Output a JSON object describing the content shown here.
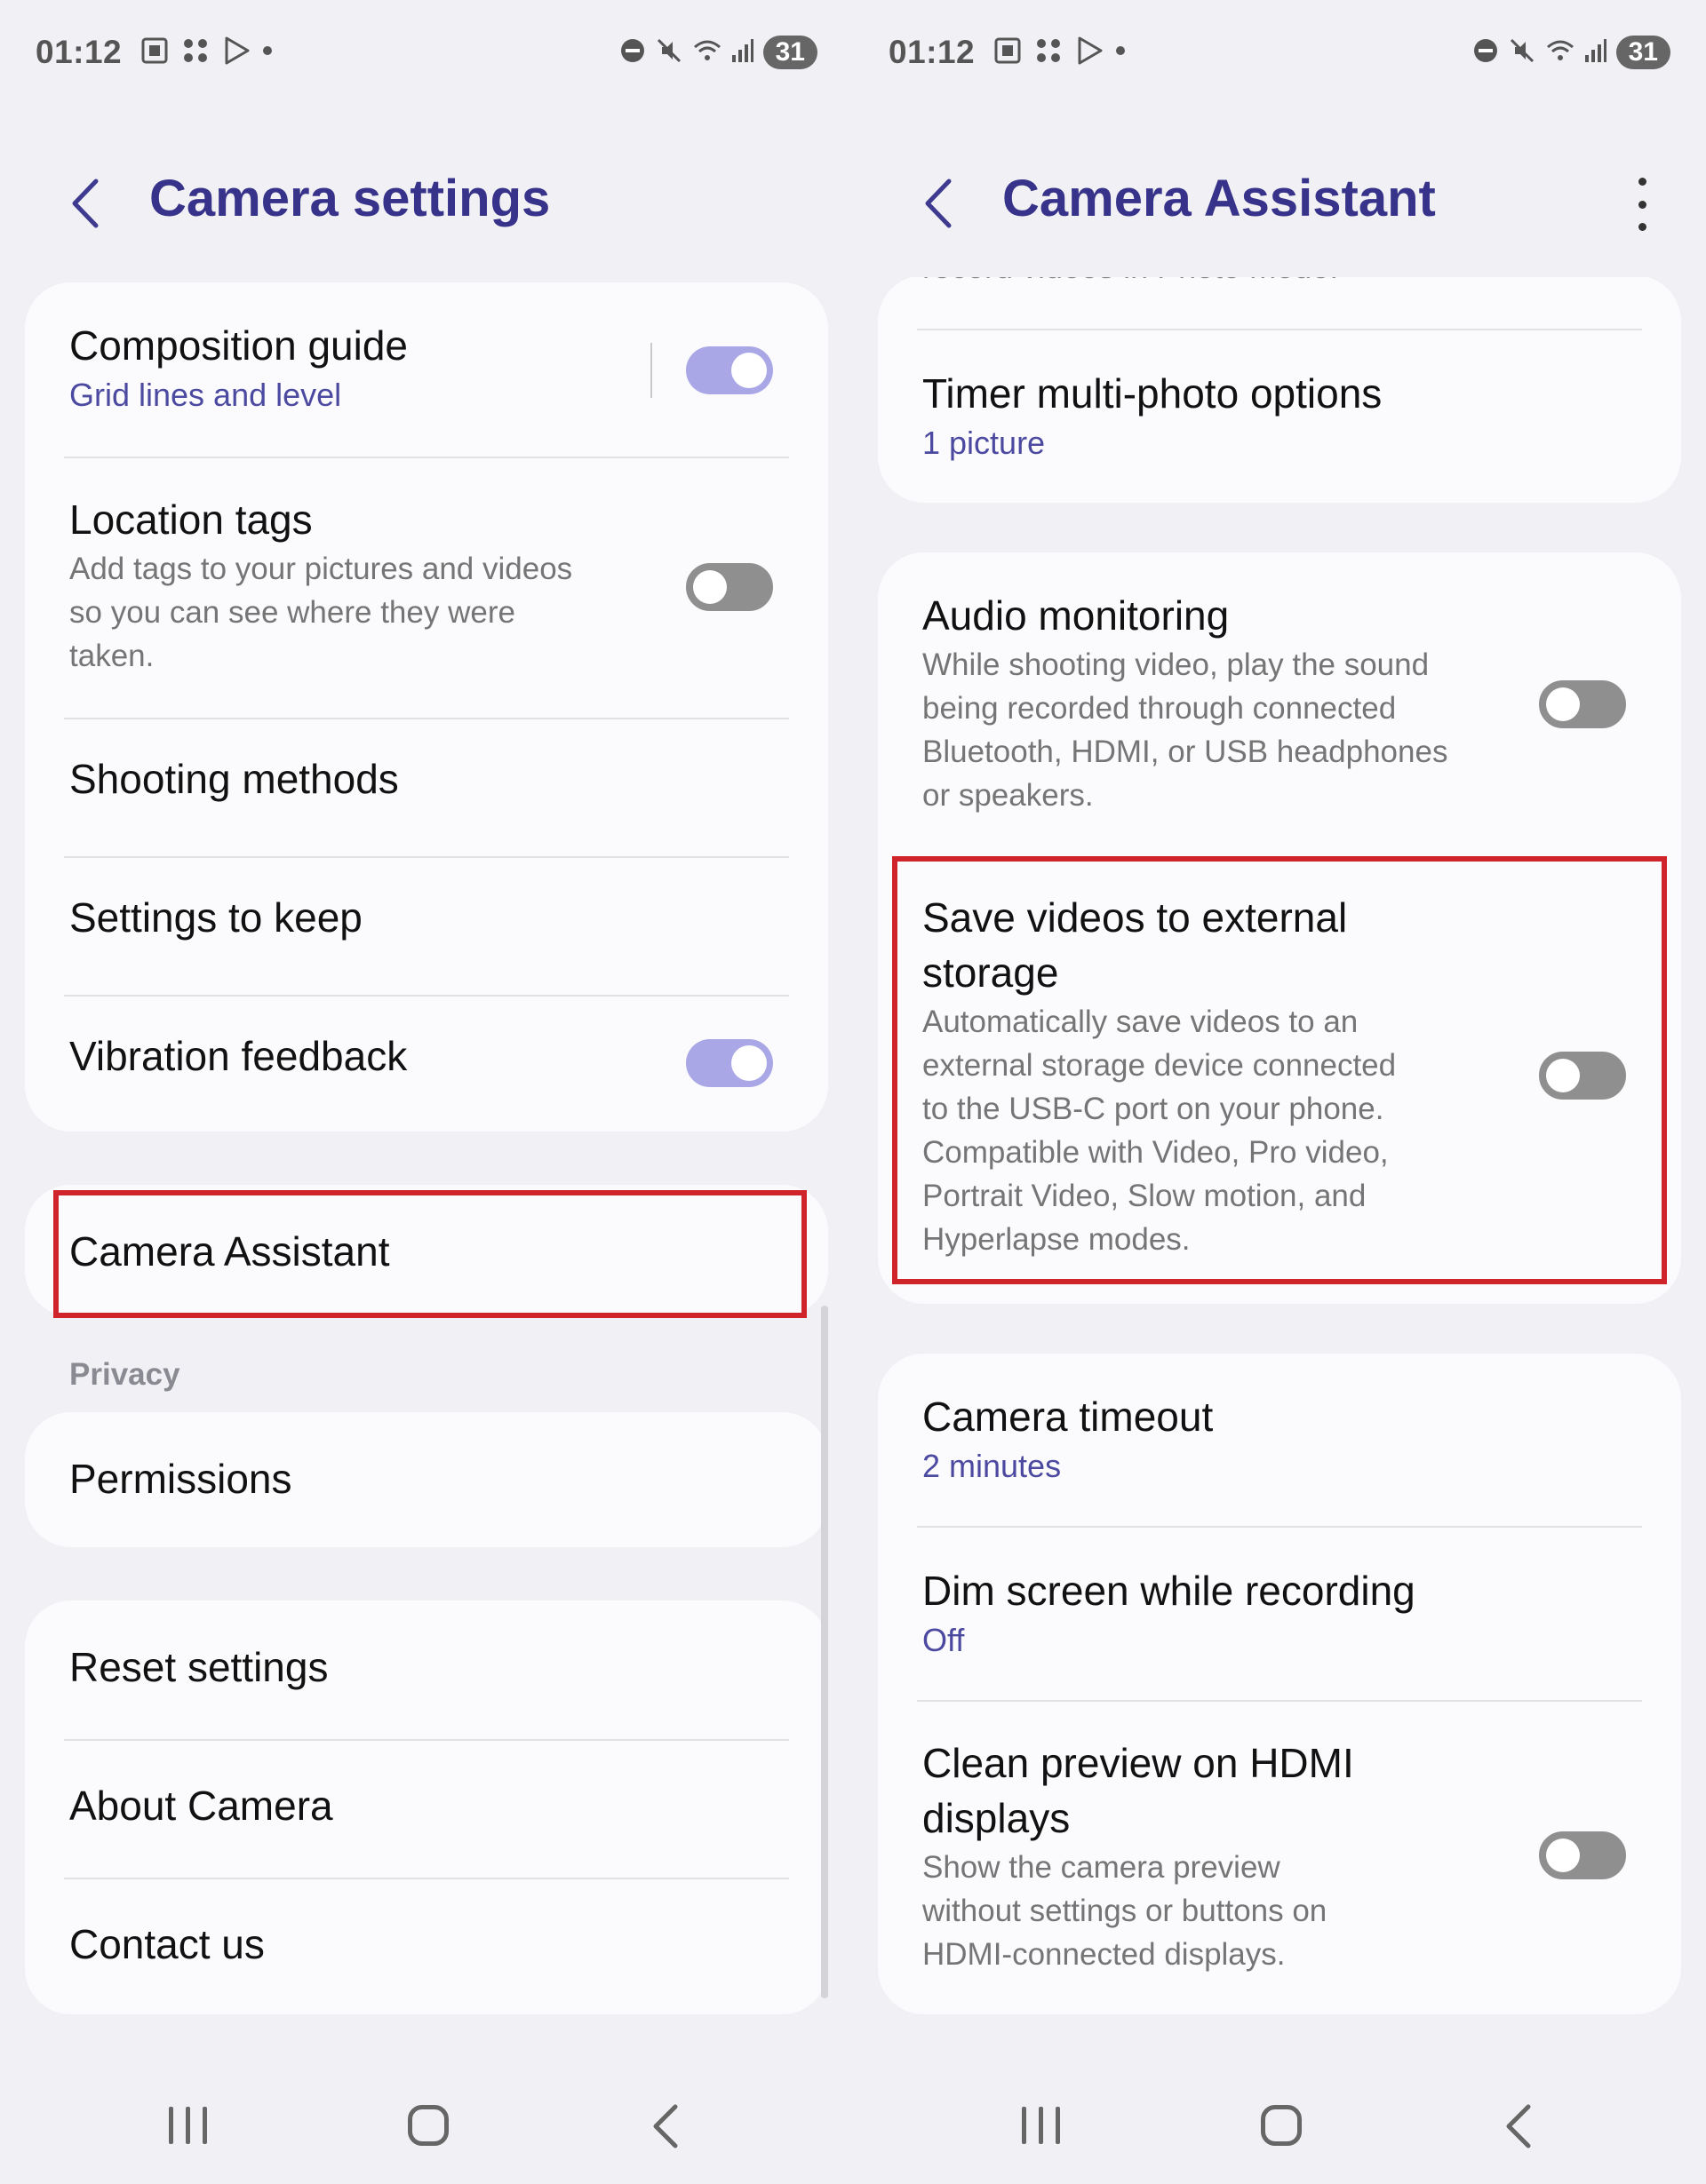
{
  "status_bar": {
    "time": "01:12",
    "battery": "31"
  },
  "left": {
    "title": "Camera settings",
    "items": {
      "composition_guide": {
        "title": "Composition guide",
        "subtitle": "Grid lines and level",
        "toggle": "on"
      },
      "location_tags": {
        "title": "Location tags",
        "desc": [
          "Add tags to your pictures and videos",
          "so you can see where they were",
          "taken."
        ],
        "toggle": "off"
      },
      "shooting_methods": {
        "title": "Shooting methods"
      },
      "settings_to_keep": {
        "title": "Settings to keep"
      },
      "vibration_feedback": {
        "title": "Vibration feedback",
        "toggle": "on"
      },
      "camera_assistant": {
        "title": "Camera Assistant"
      }
    },
    "privacy_label": "Privacy",
    "permissions": "Permissions",
    "reset_settings": "Reset settings",
    "about_camera": "About Camera",
    "contact_us": "Contact us"
  },
  "right": {
    "title": "Camera Assistant",
    "cutoff_text": "record videos in Photo mode.",
    "timer": {
      "title": "Timer multi-photo options",
      "subtitle": "1 picture"
    },
    "audio": {
      "title": "Audio monitoring",
      "desc": [
        "While shooting video, play the sound",
        "being recorded through connected",
        "Bluetooth, HDMI, or USB headphones",
        "or speakers."
      ],
      "toggle": "off"
    },
    "save_videos": {
      "title": [
        "Save videos to external",
        "storage"
      ],
      "desc": [
        "Automatically save videos to an",
        "external storage device connected",
        "to the USB-C port on your phone.",
        "Compatible with Video, Pro video,",
        "Portrait Video, Slow motion, and",
        "Hyperlapse modes."
      ],
      "toggle": "off"
    },
    "camera_timeout": {
      "title": "Camera timeout",
      "subtitle": "2 minutes"
    },
    "dim_screen": {
      "title": "Dim screen while recording",
      "subtitle": "Off"
    },
    "clean_preview": {
      "title": [
        "Clean preview on HDMI",
        "displays"
      ],
      "desc": [
        "Show the camera preview",
        "without settings or buttons on",
        "HDMI-connected displays."
      ],
      "toggle": "off"
    }
  },
  "colors": {
    "accent": "#38338a",
    "toggle_on": "#a9a7e6",
    "highlight": "#d0242b"
  }
}
